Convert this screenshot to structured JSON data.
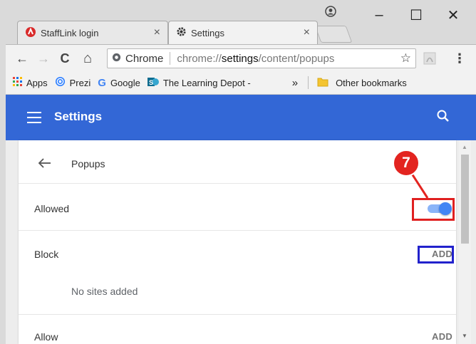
{
  "tabs": [
    {
      "title": "StaffLink login",
      "close": "×",
      "favicon": "stafflink-logo-icon"
    },
    {
      "title": "Settings",
      "close": "×",
      "favicon": "gear-icon"
    }
  ],
  "window_controls": {
    "minimize": "–",
    "maximize": "☐",
    "close": "✕"
  },
  "toolbar": {
    "back": "←",
    "forward": "→",
    "reload": "C",
    "home": "⌂",
    "omnibox": {
      "chip_label": "Chrome",
      "url_prefix": "chrome://",
      "url_host": "settings",
      "url_path": "/content/popups"
    },
    "star": "☆",
    "menu": "⋮"
  },
  "bookmarks": {
    "items": [
      {
        "label": "Apps",
        "icon": "apps-grid-icon"
      },
      {
        "label": "Prezi",
        "icon": "prezi-icon"
      },
      {
        "label": "Google",
        "icon": "google-icon"
      },
      {
        "label": "The Learning Depot -",
        "icon": "sharepoint-icon"
      }
    ],
    "overflow": "»",
    "other": "Other bookmarks"
  },
  "header": {
    "title": "Settings"
  },
  "popups": {
    "title": "Popups",
    "allowed_label": "Allowed",
    "allowed_enabled": true,
    "block_label": "Block",
    "block_add": "ADD",
    "block_empty": "No sites added",
    "allow_label": "Allow",
    "allow_add": "ADD"
  },
  "annotation": {
    "step": "7"
  },
  "colors": {
    "header": "#3367d6",
    "toggle_on": "#4285f4",
    "highlight_red": "#e02020",
    "highlight_blue": "#2222cc"
  }
}
